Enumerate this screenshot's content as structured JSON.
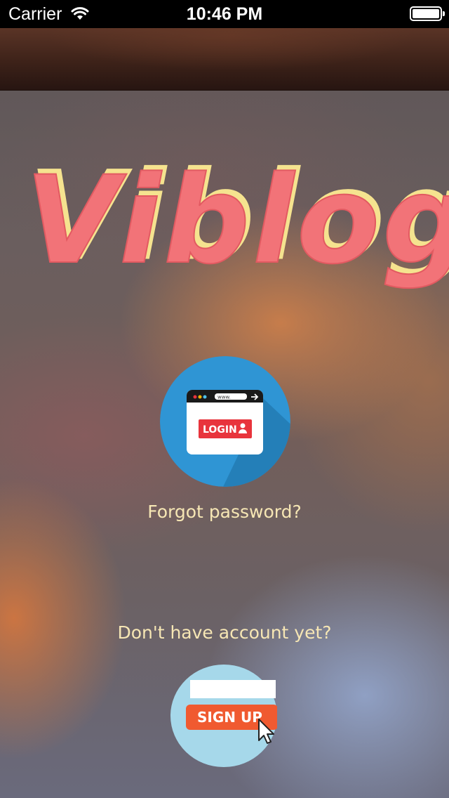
{
  "status_bar": {
    "carrier": "Carrier",
    "time": "10:46 PM",
    "wifi_icon": "wifi-icon",
    "battery_icon": "battery-icon"
  },
  "app": {
    "title": "Viblog",
    "title_color": "#f27378",
    "title_shadow_color": "#f5e38f"
  },
  "login": {
    "browser_url": "www.",
    "button_label": "LOGIN",
    "icon": "login-browser-icon",
    "circle_color": "#2f95d4",
    "button_color": "#e8343c"
  },
  "forgot_password": "Forgot password?",
  "no_account": "Don't have account yet?",
  "signup": {
    "button_label": "SIGN UP",
    "icon": "signup-cursor-icon",
    "circle_color": "#a6d8ea",
    "button_color": "#f05a30"
  },
  "colors": {
    "text_accent": "#f6e6b4"
  }
}
